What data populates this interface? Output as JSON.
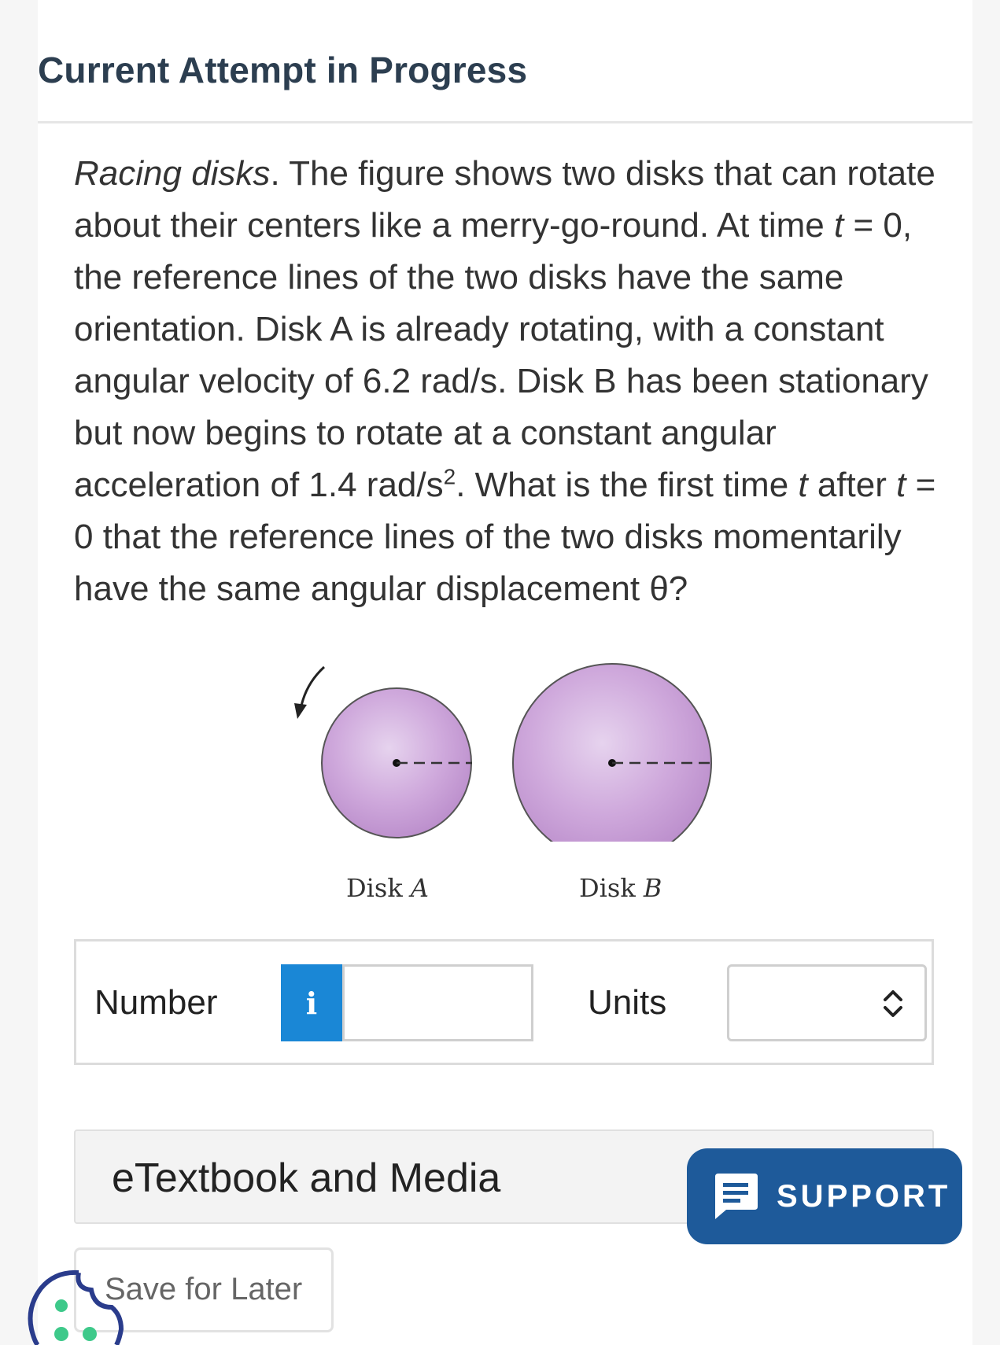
{
  "header": {
    "title": "Current Attempt in Progress"
  },
  "question": {
    "title_italic": "Racing disks",
    "body_1": ". The figure shows two disks that can rotate about their centers like a merry-go-round. At time ",
    "var_t_1": "t",
    "body_2": " = 0, the reference lines of the two disks have the same orientation. Disk A is already rotating, with a constant angular velocity of 6.2 rad/s. Disk B has been stationary but now begins to rotate at a constant angular acceleration of 1.4 rad/s",
    "superscript": "2",
    "body_3": ". What is the first time ",
    "var_t_2": "t",
    "body_4": " after ",
    "var_t_3": "t",
    "body_5": " = 0 that the reference lines of the two disks momentarily have the same angular displacement θ?"
  },
  "figure": {
    "disk_a_label": "Disk ",
    "disk_a_letter": "A",
    "disk_b_label": "Disk ",
    "disk_b_letter": "B",
    "disk_color": "#c79ed4"
  },
  "answer": {
    "number_label": "Number",
    "info_symbol": "i",
    "number_value": "",
    "units_label": "Units",
    "units_selected": ""
  },
  "etextbook": {
    "label": "eTextbook and Media"
  },
  "support": {
    "label": "SUPPORT"
  },
  "save": {
    "label": "Save for Later"
  },
  "colors": {
    "info_blue": "#1a87d6",
    "support_blue": "#1e5a9a",
    "cookie_green": "#3ec98a"
  }
}
